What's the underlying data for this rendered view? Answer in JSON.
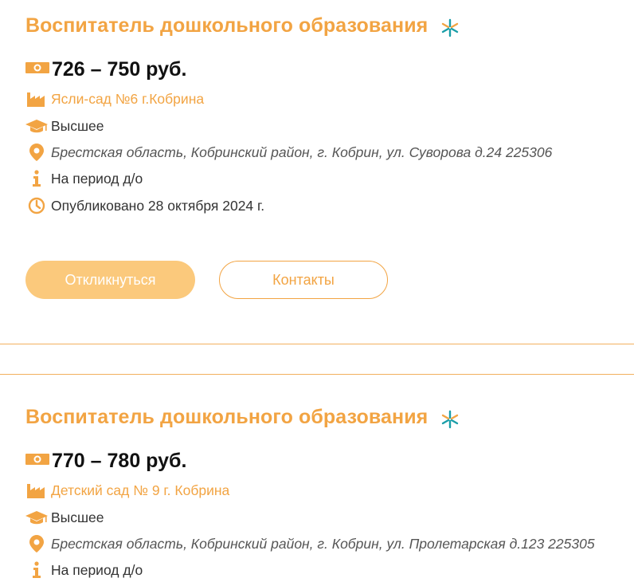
{
  "colors": {
    "accent": "#f2a443",
    "button_fill": "#fbc97c",
    "icon_teal": "#1a9ea8",
    "text_dark": "#111111"
  },
  "vacancies": [
    {
      "title": "Воспитатель дошкольного образования",
      "title_icon": "sparkle-icon",
      "salary": "726 – 750 руб.",
      "organization": "Ясли-сад №6 г.Кобрина",
      "education": "Высшее",
      "address": "Брестская область, Кобринский район, г. Кобрин, ул. Суворова д.24 225306",
      "period": "На период д/о",
      "published": "Опубликовано 28 октября 2024 г.",
      "apply_label": "Откликнуться",
      "contacts_label": "Контакты"
    },
    {
      "title": "Воспитатель дошкольного образования",
      "title_icon": "sparkle-icon",
      "salary": "770 – 780 руб.",
      "organization": "Детский сад № 9 г. Кобрина",
      "education": "Высшее",
      "address": "Брестская область, Кобринский район, г. Кобрин, ул. Пролетарская д.123 225305",
      "period": "На период д/о"
    }
  ]
}
